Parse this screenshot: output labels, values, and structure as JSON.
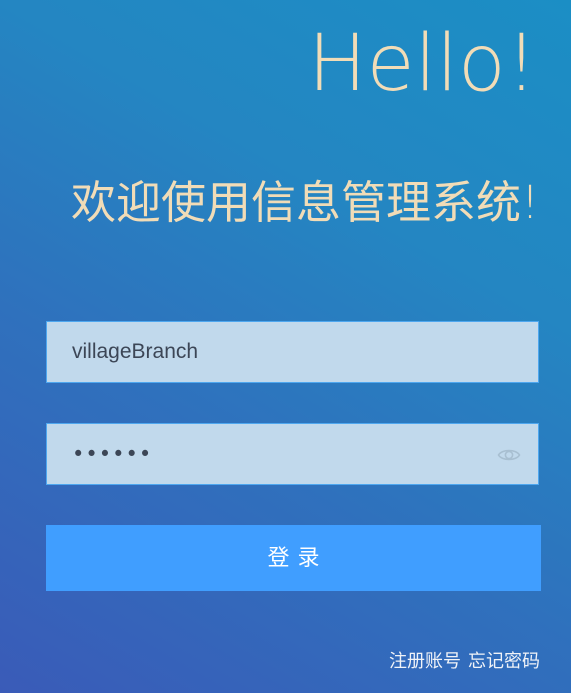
{
  "header": {
    "hello": "Hello!",
    "welcome": "欢迎使用信息管理系统!"
  },
  "login_form": {
    "username": {
      "value": "villageBranch",
      "placeholder": ""
    },
    "password": {
      "masked_value": "••••••",
      "visibility_icon": "eye-icon"
    },
    "submit_label": "登录"
  },
  "footer_links": {
    "register": "注册账号",
    "forgot_password": "忘记密码"
  },
  "colors": {
    "heading_text": "#f1dcb7",
    "input_background": "#c1d9ec",
    "primary_button": "#409eff"
  }
}
